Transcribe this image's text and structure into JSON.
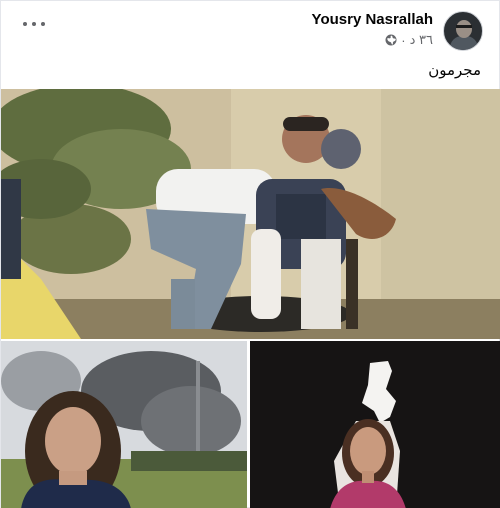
{
  "post": {
    "author_name": "Yousry Nasrallah",
    "timestamp": "٣٦ د",
    "separator": "·",
    "audience_icon": "globe-icon",
    "caption": "مجرمون",
    "more_icon": "more-options-icon"
  },
  "images": {
    "main": "photo",
    "left": "photo",
    "right": "photo"
  },
  "colors": {
    "text_primary": "#050505",
    "text_secondary": "#65676b",
    "border": "#e4e6eb"
  }
}
